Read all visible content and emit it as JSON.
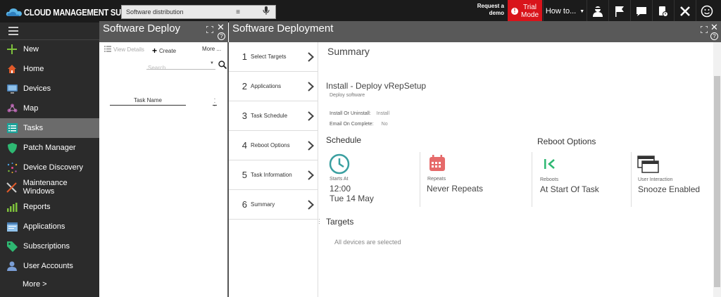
{
  "topbar": {
    "brand": "CLOUD MANAGEMENT SUITE",
    "search_value": "Software distribution",
    "request_demo": "Request a demo",
    "trial_line1": "Trial",
    "trial_line2": "Mode",
    "howto": "How to...",
    "icons": [
      "menu-icon",
      "microphone-icon",
      "user-icon",
      "flag-icon",
      "chat-icon",
      "lock-icon",
      "tools-icon",
      "smile-icon"
    ],
    "trial_color": "#d9141b"
  },
  "leftnav": {
    "items": [
      {
        "label": "New",
        "icon": "plus-icon"
      },
      {
        "label": "Home",
        "icon": "home-icon"
      },
      {
        "label": "Devices",
        "icon": "monitor-icon"
      },
      {
        "label": "Map",
        "icon": "map-icon"
      },
      {
        "label": "Tasks",
        "icon": "tasks-icon",
        "active": true
      },
      {
        "label": "Patch Manager",
        "icon": "shield-icon"
      },
      {
        "label": "Device Discovery",
        "icon": "discovery-icon"
      },
      {
        "label": "Maintenance Windows",
        "icon": "maintenance-icon"
      },
      {
        "label": "Reports",
        "icon": "reports-icon"
      },
      {
        "label": "Applications",
        "icon": "applications-icon"
      },
      {
        "label": "Subscriptions",
        "icon": "subscriptions-icon"
      },
      {
        "label": "User Accounts",
        "icon": "user-accounts-icon"
      }
    ],
    "more": "More >"
  },
  "panel1": {
    "title": "Software Deploy",
    "view_details": "View Details",
    "create": "Create",
    "more": "More ...",
    "search_placeholder": "Search",
    "column_task_name": "Task Name"
  },
  "main": {
    "title": "Software Deployment",
    "steps": [
      {
        "num": "1",
        "label": "Select Targets"
      },
      {
        "num": "2",
        "label": "Applications"
      },
      {
        "num": "3",
        "label": "Task Schedule"
      },
      {
        "num": "4",
        "label": "Reboot Options"
      },
      {
        "num": "5",
        "label": "Task Information"
      },
      {
        "num": "6",
        "label": "Summary"
      }
    ],
    "summary": {
      "heading": "Summary",
      "job_title": "Install - Deploy vRepSetup",
      "job_subtitle": "Deploy software",
      "install_label": "Install Or Uninstall:",
      "install_value": "Install",
      "email_label": "Email On Complete:",
      "email_value": "No",
      "schedule_heading": "Schedule",
      "reboot_heading": "Reboot Options",
      "starts_at_label": "Starts At",
      "starts_at_time": "12:00",
      "starts_at_date": "Tue 14 May",
      "repeats_label": "Repeats",
      "repeats_value": "Never Repeats",
      "reboots_label": "Reboots",
      "reboots_value": "At Start Of Task",
      "interaction_label": "User Interaction",
      "interaction_value": "Snooze Enabled",
      "targets_heading": "Targets",
      "targets_note": "All devices are selected"
    }
  }
}
